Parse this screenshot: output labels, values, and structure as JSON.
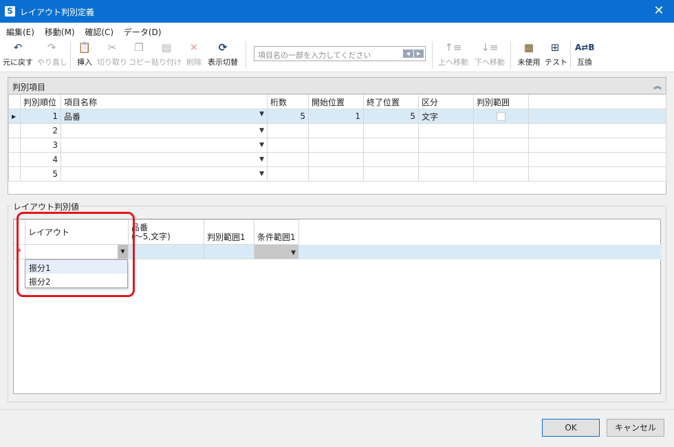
{
  "window": {
    "title": "レイアウト判別定義",
    "app_icon": "S",
    "close": "✕"
  },
  "menu": [
    "編集(E)",
    "移動(M)",
    "確認(C)",
    "データ(D)"
  ],
  "toolbar": {
    "undo": "元に戻す",
    "redo": "やり直し",
    "insert": "挿入",
    "cut": "切り取り",
    "copy": "コピー",
    "paste": "貼り付け",
    "delete": "削除",
    "toggle_display": "表示切替",
    "search_placeholder": "項目名の一部を入力してください",
    "move_up": "上へ移動",
    "move_down": "下へ移動",
    "unused": "未使用",
    "test": "テスト",
    "swap": "互換"
  },
  "items_panel": {
    "title": "判別項目",
    "columns": [
      "判別順位",
      "項目名称",
      "桁数",
      "開始位置",
      "終了位置",
      "区分",
      "判別範囲"
    ],
    "rows": [
      {
        "order": "1",
        "name": "品番",
        "digits": "5",
        "start": "1",
        "end": "5",
        "kind": "文字"
      },
      {
        "order": "2",
        "name": "",
        "digits": "",
        "start": "",
        "end": "",
        "kind": ""
      },
      {
        "order": "3",
        "name": "",
        "digits": "",
        "start": "",
        "end": "",
        "kind": ""
      },
      {
        "order": "4",
        "name": "",
        "digits": "",
        "start": "",
        "end": "",
        "kind": ""
      },
      {
        "order": "5",
        "name": "",
        "digits": "",
        "start": "",
        "end": "",
        "kind": ""
      }
    ]
  },
  "layout_values": {
    "group_label": "レイアウト判別値",
    "col_layout": "レイアウト",
    "col_item_line1": "品番",
    "col_item_line2": "(～5,文字)",
    "col_range": "判別範囲1",
    "col_condition": "条件範囲1",
    "new_row_marker": "*",
    "dropdown_options": [
      "振分1",
      "振分2"
    ]
  },
  "buttons": {
    "ok": "OK",
    "cancel": "キャンセル"
  },
  "colors": {
    "title_bar": "#0a6fd0",
    "selected_row": "#d9eaf7",
    "highlight": "#e3141a"
  }
}
